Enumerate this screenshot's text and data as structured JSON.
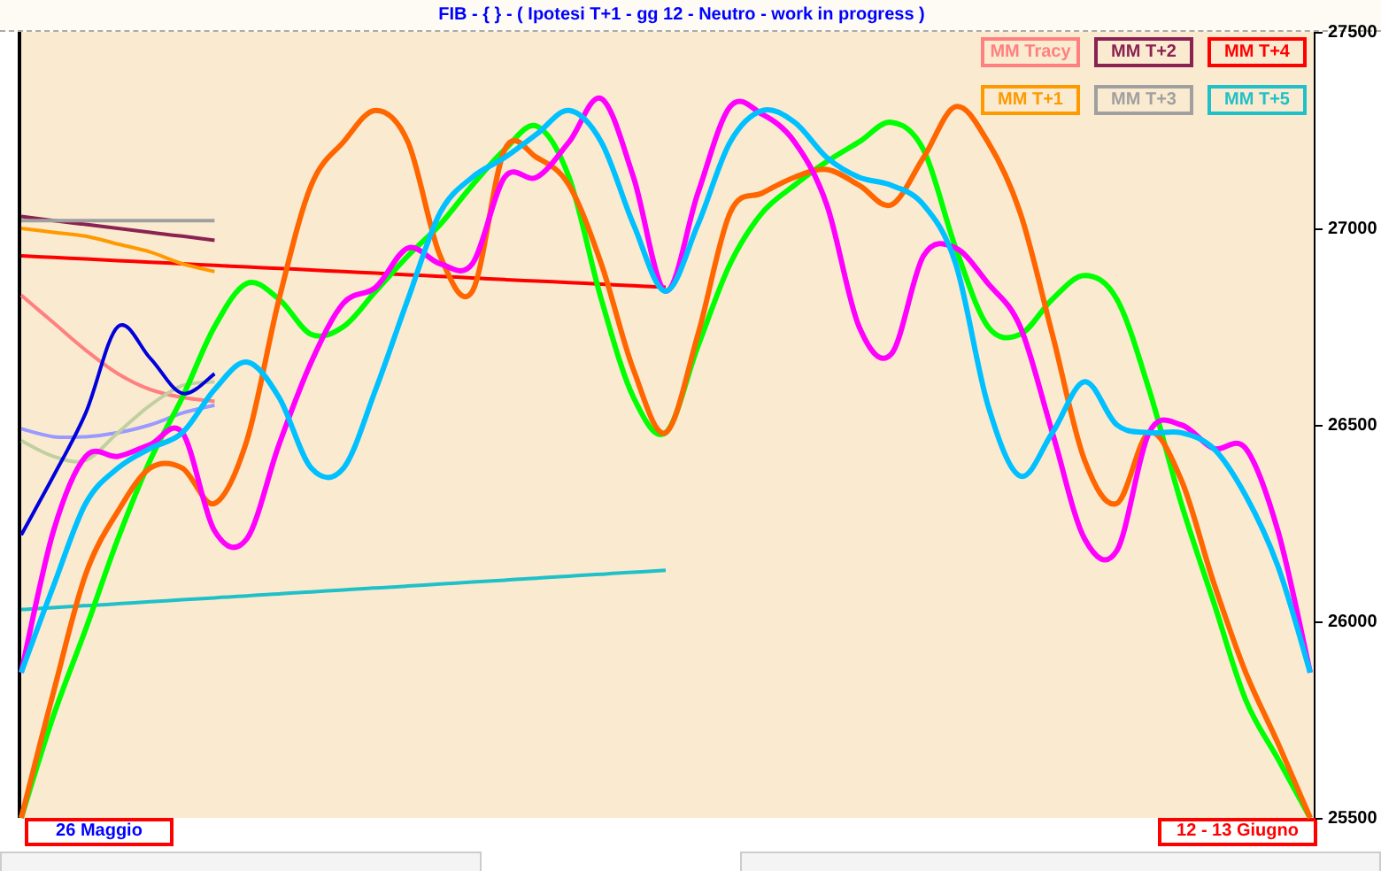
{
  "title": "FIB  -  {  } - ( Ipotesi  T+1  -  gg 12  -  Neutro  -  work in progress )",
  "chart_data": {
    "type": "line",
    "ylim": [
      25500,
      27500
    ],
    "yticks": [
      {
        "value": 27500,
        "label": "27500"
      },
      {
        "value": 27000,
        "label": "27000"
      },
      {
        "value": 26500,
        "label": "26500"
      },
      {
        "value": 26000,
        "label": "26000"
      },
      {
        "value": 25500,
        "label": "25500"
      }
    ],
    "series": [
      {
        "name": "MM  Tracy",
        "color": "#ff8080",
        "values": [
          26830,
          26760,
          26690,
          26630,
          26590,
          26570,
          26560,
          null,
          null,
          null,
          null,
          null,
          null,
          null,
          null,
          null,
          null,
          null,
          null,
          null,
          null,
          null,
          null,
          null,
          null,
          null,
          null,
          null,
          null,
          null,
          null,
          null,
          null,
          null,
          null,
          null,
          null,
          null,
          null,
          null,
          null
        ]
      },
      {
        "name": "MM  T+2",
        "color": "#8b2252",
        "values": [
          27030,
          27020,
          27010,
          27000,
          26990,
          26980,
          26970,
          null,
          null,
          null,
          null,
          null,
          null,
          null,
          null,
          null,
          null,
          null,
          null,
          null,
          null,
          null,
          null,
          null,
          null,
          null,
          null,
          null,
          null,
          null,
          null,
          null,
          null,
          null,
          null,
          null,
          null,
          null,
          null,
          null,
          null
        ]
      },
      {
        "name": "MM  T+4",
        "color": "#ff0000",
        "values": [
          26930,
          26926,
          26922,
          26918,
          26914,
          26910,
          26906,
          26902,
          26898,
          26894,
          26890,
          26886,
          26882,
          26878,
          26874,
          26870,
          26866,
          26862,
          26858,
          26854,
          26850,
          null,
          null,
          null,
          null,
          null,
          null,
          null,
          null,
          null,
          null,
          null,
          null,
          null,
          null,
          null,
          null,
          null,
          null,
          null,
          null
        ]
      },
      {
        "name": "MM  T+1",
        "color": "#ff9900",
        "values": [
          27000,
          26990,
          26980,
          26960,
          26940,
          26910,
          26890,
          null,
          null,
          null,
          null,
          null,
          null,
          null,
          null,
          null,
          null,
          null,
          null,
          null,
          null,
          null,
          null,
          null,
          null,
          null,
          null,
          null,
          null,
          null,
          null,
          null,
          null,
          null,
          null,
          null,
          null,
          null,
          null,
          null,
          null
        ]
      },
      {
        "name": "MM  T+3",
        "color": "#a0a0a0",
        "values": [
          27020,
          27020,
          27020,
          27020,
          27020,
          27020,
          27020,
          null,
          null,
          null,
          null,
          null,
          null,
          null,
          null,
          null,
          null,
          null,
          null,
          null,
          null,
          null,
          null,
          null,
          null,
          null,
          null,
          null,
          null,
          null,
          null,
          null,
          null,
          null,
          null,
          null,
          null,
          null,
          null,
          null,
          null
        ]
      },
      {
        "name": "MM  T+5",
        "color": "#20c0c8",
        "values": [
          26030,
          26035,
          26040,
          26045,
          26050,
          26055,
          26060,
          26065,
          26070,
          26075,
          26080,
          26085,
          26090,
          26095,
          26100,
          26105,
          26110,
          26115,
          26120,
          26125,
          26130,
          null,
          null,
          null,
          null,
          null,
          null,
          null,
          null,
          null,
          null,
          null,
          null,
          null,
          null,
          null,
          null,
          null,
          null,
          null,
          null
        ]
      },
      {
        "color": "#9999ff",
        "values": [
          26490,
          26470,
          26470,
          26480,
          26500,
          26530,
          26550,
          null,
          null,
          null,
          null,
          null,
          null,
          null,
          null,
          null,
          null,
          null,
          null,
          null,
          null,
          null,
          null,
          null,
          null,
          null,
          null,
          null,
          null,
          null,
          null,
          null,
          null,
          null,
          null,
          null,
          null,
          null,
          null,
          null,
          null
        ]
      },
      {
        "color": "#c0d0a0",
        "values": [
          26460,
          26420,
          26410,
          26480,
          26550,
          26600,
          26610,
          null,
          null,
          null,
          null,
          null,
          null,
          null,
          null,
          null,
          null,
          null,
          null,
          null,
          null,
          null,
          null,
          null,
          null,
          null,
          null,
          null,
          null,
          null,
          null,
          null,
          null,
          null,
          null,
          null,
          null,
          null,
          null,
          null,
          null
        ]
      },
      {
        "color": "#00ff00",
        "values": [
          25500,
          25760,
          25980,
          26210,
          26410,
          26570,
          26750,
          26860,
          26820,
          26730,
          26750,
          26840,
          26930,
          27010,
          27110,
          27200,
          27260,
          27130,
          26820,
          26570,
          26480,
          26700,
          26910,
          27040,
          27110,
          27170,
          27220,
          27270,
          27200,
          26950,
          26750,
          26730,
          26820,
          26880,
          26820,
          26590,
          26300,
          26050,
          25800,
          25650,
          25500
        ]
      },
      {
        "color": "#ff6600",
        "values": [
          25500,
          25820,
          26120,
          26280,
          26390,
          26390,
          26300,
          26460,
          26820,
          27110,
          27220,
          27300,
          27220,
          26930,
          26840,
          27200,
          27180,
          27110,
          26910,
          26640,
          26480,
          26730,
          27040,
          27090,
          27130,
          27150,
          27110,
          27060,
          27180,
          27310,
          27220,
          27040,
          26730,
          26410,
          26300,
          26480,
          26360,
          26100,
          25870,
          25690,
          25500
        ]
      },
      {
        "color": "#ff00ff",
        "values": [
          25870,
          26230,
          26420,
          26420,
          26450,
          26480,
          26230,
          26210,
          26450,
          26660,
          26810,
          26850,
          26950,
          26910,
          26910,
          27130,
          27130,
          27220,
          27330,
          27130,
          26840,
          27090,
          27310,
          27290,
          27220,
          27060,
          26750,
          26680,
          26930,
          26950,
          26860,
          26750,
          26480,
          26210,
          26180,
          26480,
          26500,
          26440,
          26440,
          26230,
          25870
        ]
      },
      {
        "color": "#00c0ff",
        "values": [
          25870,
          26090,
          26300,
          26390,
          26440,
          26480,
          26590,
          26660,
          26570,
          26390,
          26390,
          26590,
          26820,
          27040,
          27130,
          27180,
          27240,
          27300,
          27220,
          27010,
          26840,
          27010,
          27220,
          27300,
          27270,
          27180,
          27130,
          27110,
          27060,
          26910,
          26550,
          26370,
          26480,
          26610,
          26500,
          26480,
          26480,
          26440,
          26320,
          26140,
          25870
        ]
      },
      {
        "color": "#0000dd",
        "values": [
          26220,
          26370,
          26530,
          26750,
          26670,
          26580,
          26630,
          null,
          null,
          null,
          null,
          null,
          null,
          null,
          null,
          null,
          null,
          null,
          null,
          null,
          null,
          null,
          null,
          null,
          null,
          null,
          null,
          null,
          null,
          null,
          null,
          null,
          null,
          null,
          null,
          null,
          null,
          null,
          null,
          null,
          null
        ]
      }
    ]
  },
  "date_labels": [
    {
      "label": "26  Maggio",
      "color": "#0000ff"
    },
    {
      "label": "12 - 13  Giugno",
      "color": "#ff0000"
    }
  ]
}
